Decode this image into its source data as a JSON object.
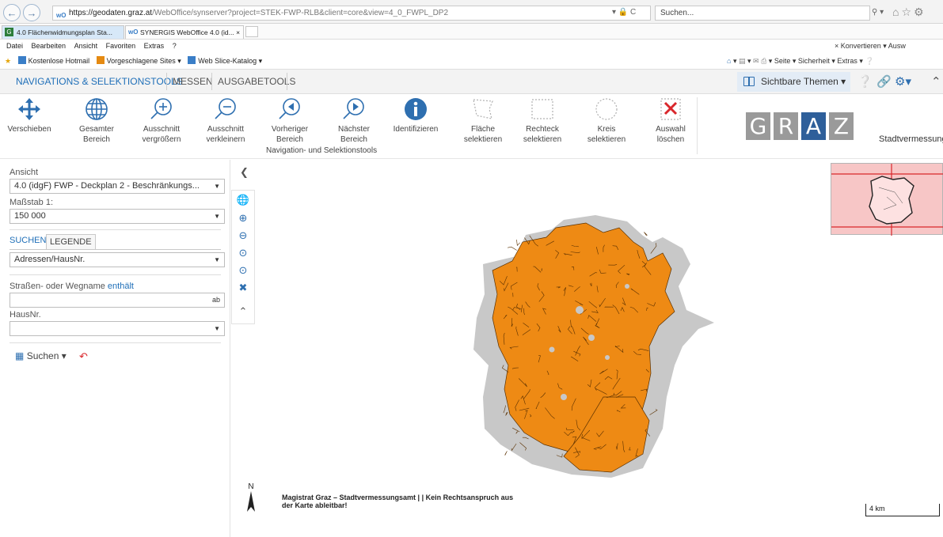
{
  "browser": {
    "url_host": "https://geodaten.graz.at",
    "url_path": "/WebOffice/synserver?project=STEK-FWP-RLB&client=core&view=4_0_FWPL_DP2",
    "url_controls": "▾ 🔒 C",
    "search_placeholder": "Suchen...",
    "tabs": [
      {
        "label": "4.0 Flächenwidmungsplan Sta..."
      },
      {
        "label": "SYNERGIS WebOffice 4.0 (id... ×"
      }
    ],
    "menu": [
      "Datei",
      "Bearbeiten",
      "Ansicht",
      "Favoriten",
      "Extras",
      "?"
    ],
    "menu_right": "×  Konvertieren  ▾  Ausw",
    "favorites": [
      "Kostenlose Hotmail",
      "Vorgeschlagene Sites ▾",
      "Web Slice-Katalog ▾"
    ],
    "command_bar": "Seite ▾  Sicherheit ▾  Extras ▾"
  },
  "app": {
    "tabs": {
      "nav": "NAVIGATIONS & SELEKTIONSTOOLS",
      "messen": "MESSEN",
      "ausgabe": "AUSGABETOOLS"
    },
    "themen": "Sichtbare Themen ▾",
    "tools": [
      {
        "l1": "Verschieben",
        "l2": ""
      },
      {
        "l1": "Gesamter",
        "l2": "Bereich"
      },
      {
        "l1": "Ausschnitt",
        "l2": "vergrößern"
      },
      {
        "l1": "Ausschnitt",
        "l2": "verkleinern"
      },
      {
        "l1": "Vorheriger",
        "l2": "Bereich"
      },
      {
        "l1": "Nächster",
        "l2": "Bereich"
      },
      {
        "l1": "Identifizieren",
        "l2": ""
      },
      {
        "l1": "Fläche",
        "l2": "selektieren"
      },
      {
        "l1": "Rechteck",
        "l2": "selektieren"
      },
      {
        "l1": "Kreis",
        "l2": "selektieren"
      },
      {
        "l1": "Auswahl",
        "l2": "löschen"
      }
    ],
    "tools_caption": "Navigation- und Selektionstools",
    "logo_letters": [
      "G",
      "R",
      "A",
      "Z"
    ],
    "logo_colors": [
      "#9a9a9a",
      "#9a9a9a",
      "#2e5f9a",
      "#9a9a9a"
    ],
    "stadt": "Stadtvermessung"
  },
  "panel": {
    "ansicht_label": "Ansicht",
    "ansicht_value": "4.0 (idgF) FWP - Deckplan 2 - Beschränkungs...",
    "massstab_label": "Maßstab 1:",
    "massstab_value": "150 000",
    "tab_suchen": "SUCHEN",
    "tab_legende": "LEGENDE",
    "search_type": "Adressen/HausNr.",
    "strasse_label": "Straßen- oder Wegname",
    "strasse_mode": "enthält",
    "strasse_value": "",
    "hausnr_label": "HausNr.",
    "hausnr_value": "",
    "suchen_button": "Suchen ▾"
  },
  "map": {
    "credit_line1": "Magistrat Graz – Stadtvermessungsamt | | Kein Rechtsanspruch aus",
    "credit_line2": "der Karte ableitbar!",
    "north_label": "N",
    "scale_label": "4 km",
    "colors": {
      "zone": "#ee8a14",
      "grey": "#c8c8c8",
      "accent": "#1f6fb8",
      "overview": "#f7c6c6"
    }
  }
}
